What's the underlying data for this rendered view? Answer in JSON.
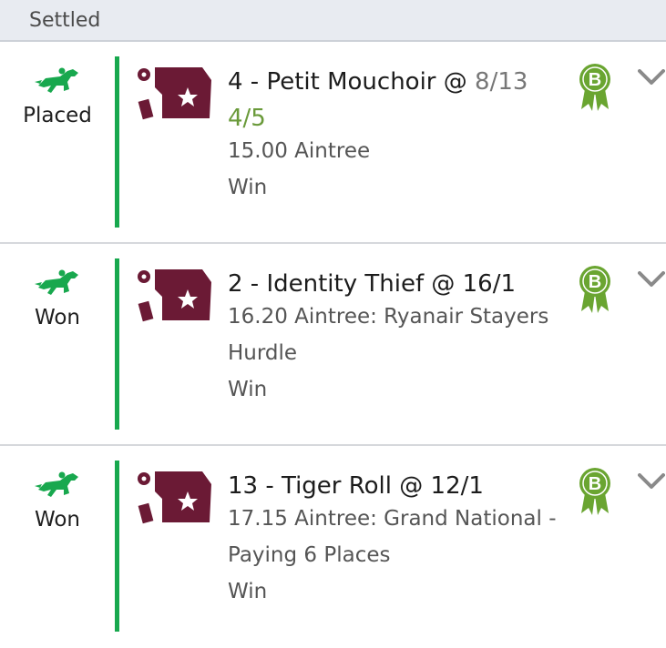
{
  "section": {
    "title": "Settled"
  },
  "colors": {
    "won_green": "#18a84e",
    "badge_green": "#6aa531",
    "silk": "#6b1a35",
    "odds_boost": "#6a9a3a"
  },
  "bets": [
    {
      "status": "Placed",
      "selection": "4 - Petit Mouchoir @ ",
      "price_old": "8/13",
      "price_new": "4/5",
      "event_line1": "15.00 Aintree",
      "event_line2": "",
      "bet_type": "Win",
      "badge_letter": "B",
      "icons": [
        "horse-icon",
        "jockey-silk-icon",
        "badge-icon",
        "chevron-down-icon"
      ]
    },
    {
      "status": "Won",
      "selection": "2 - Identity Thief @ 16/1",
      "event_line1": "16.20 Aintree: Ryanair Stayers",
      "event_line2": "Hurdle",
      "bet_type": "Win",
      "badge_letter": "B",
      "icons": [
        "horse-icon",
        "jockey-silk-icon",
        "badge-icon",
        "chevron-down-icon"
      ]
    },
    {
      "status": "Won",
      "selection": "13 - Tiger Roll @ 12/1",
      "event_line1": "17.15 Aintree: Grand National -",
      "event_line2": "Paying 6 Places",
      "bet_type": "Win",
      "badge_letter": "B",
      "icons": [
        "horse-icon",
        "jockey-silk-icon",
        "badge-icon",
        "chevron-down-icon"
      ]
    }
  ]
}
